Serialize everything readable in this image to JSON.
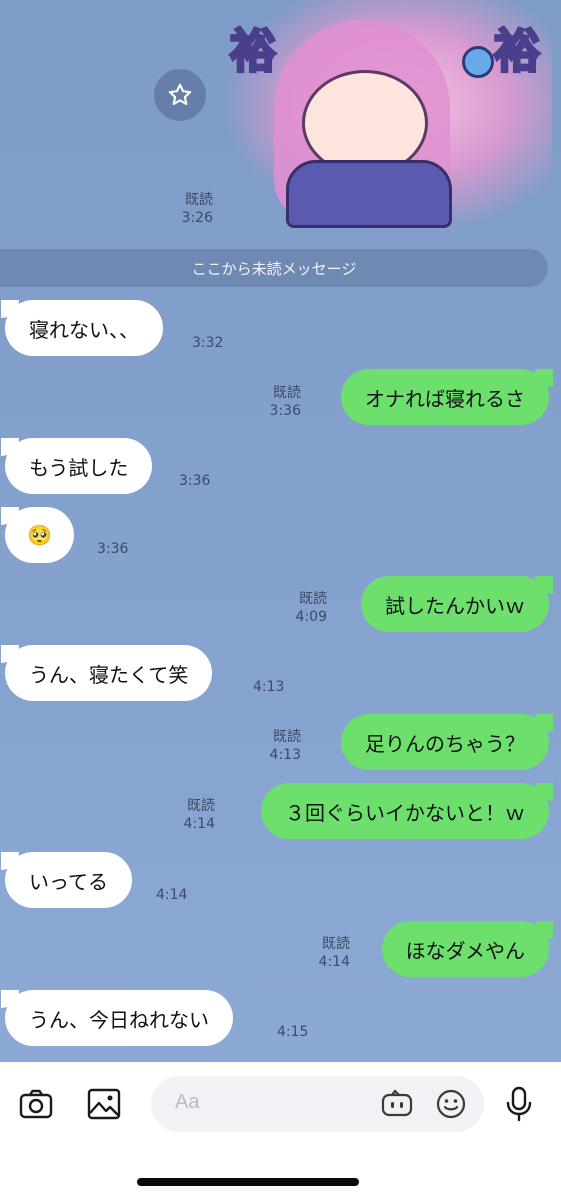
{
  "sticker": {
    "left_text": "裕",
    "right_text": "裕",
    "read": "既読",
    "time": "3:26"
  },
  "divider_label": "ここから未読メッセージ",
  "messages": [
    {
      "side": "in",
      "text": "寝れない、、",
      "time": "3:32",
      "read": ""
    },
    {
      "side": "out",
      "text": "オナれば寝れるさ",
      "time": "3:36",
      "read": "既読"
    },
    {
      "side": "in",
      "text": "もう試した",
      "time": "3:36",
      "read": ""
    },
    {
      "side": "in",
      "text": "🥺",
      "time": "3:36",
      "read": ""
    },
    {
      "side": "out",
      "text": "試したんかいｗ",
      "time": "4:09",
      "read": "既読"
    },
    {
      "side": "in",
      "text": "うん、寝たくて笑",
      "time": "4:13",
      "read": ""
    },
    {
      "side": "out",
      "text": "足りんのちゃう？",
      "time": "4:13",
      "read": "既読"
    },
    {
      "side": "out",
      "text": "３回ぐらいイかないと！ｗ",
      "time": "4:14",
      "read": "既読"
    },
    {
      "side": "in",
      "text": "いってる",
      "time": "4:14",
      "read": ""
    },
    {
      "side": "out",
      "text": "ほなダメやん",
      "time": "4:14",
      "read": "既読"
    },
    {
      "side": "in",
      "text": "うん、今日ねれない",
      "time": "4:15",
      "read": ""
    }
  ],
  "composer": {
    "placeholder": "Aa"
  },
  "icons": {
    "star": "star-icon",
    "camera": "camera-icon",
    "image": "image-icon",
    "sticker": "sticker-icon",
    "emoji": "emoji-icon",
    "mic": "microphone-icon"
  },
  "colors": {
    "background": "#86a2cf",
    "outgoing_bubble": "#6cdf6d",
    "incoming_bubble": "#ffffff"
  }
}
